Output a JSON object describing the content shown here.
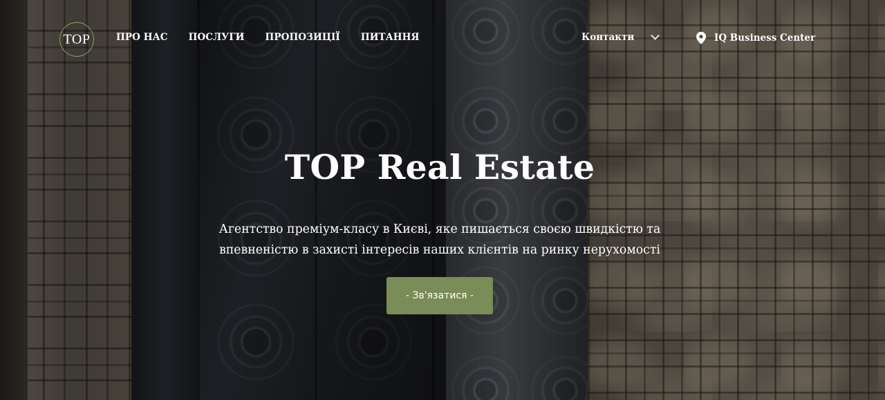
{
  "header": {
    "logo_text": "TOP",
    "nav": [
      {
        "label": "ПРО НАС"
      },
      {
        "label": "ПОСЛУГИ"
      },
      {
        "label": "ПРОПОЗИЦІЇ"
      },
      {
        "label": "ПИТАННЯ"
      }
    ],
    "contacts_label": "Контакти",
    "location_label": "IQ Business Center"
  },
  "hero": {
    "title": "TOP Real Estate",
    "subtitle_line1": "Агентство преміум-класу в Києві, яке пишається своєю швидкістю та",
    "subtitle_line2": "впевненістю в захисті інтересів наших клієнтів на ринку нерухомості",
    "cta_label": "- Зв'язатися -"
  },
  "colors": {
    "accent": "#7a8c57",
    "logo_border": "#8aa06a",
    "text": "#ffffff"
  },
  "icons": {
    "location": "map-pin-icon",
    "dropdown": "chevron-down-icon"
  }
}
